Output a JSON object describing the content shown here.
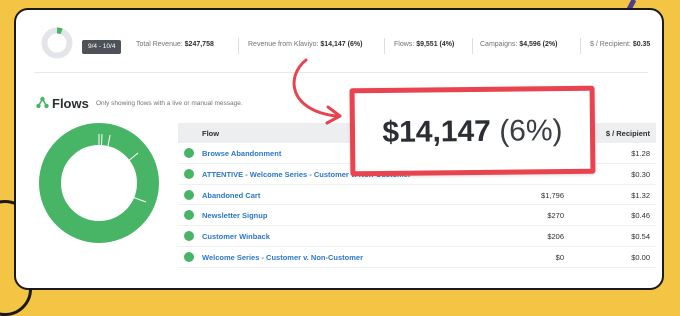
{
  "summary": {
    "date_range": "9/4 - 10/4",
    "stats": [
      {
        "label": "Total Revenue:",
        "value": "$247,758"
      },
      {
        "label": "Revenue from Klaviyo:",
        "value": "$14,147 (6%)"
      },
      {
        "label": "Flows:",
        "value": "$9,551 (4%)"
      },
      {
        "label": "Campaigns:",
        "value": "$4,596 (2%)"
      },
      {
        "label": "$ / Recipient:",
        "value": "$0.35"
      }
    ]
  },
  "flows": {
    "title": "Flows",
    "subtitle": "Only showing flows with a live or manual message.",
    "columns": {
      "flow": "Flow",
      "revenue": "",
      "per_recipient": "$ / Recipient"
    },
    "rows": [
      {
        "name": "Browse Abandonment",
        "revenue": "",
        "per_recipient": "$1.28"
      },
      {
        "name": "ATTENTIVE - Welcome Series - Customer v. Non-Customer",
        "revenue": "",
        "per_recipient": "$0.30"
      },
      {
        "name": "Abandoned Cart",
        "revenue": "$1,796",
        "per_recipient": "$1.32"
      },
      {
        "name": "Newsletter Signup",
        "revenue": "$270",
        "per_recipient": "$0.46"
      },
      {
        "name": "Customer Winback",
        "revenue": "$206",
        "per_recipient": "$0.54"
      },
      {
        "name": "Welcome Series - Customer v. Non-Customer",
        "revenue": "$0",
        "per_recipient": "$0.00"
      }
    ]
  },
  "callout": {
    "amount": "$14,147",
    "percent": "(6%)"
  },
  "colors": {
    "background": "#f4c545",
    "accent_green": "#47b565",
    "link_blue": "#2b77c7",
    "callout_red": "#e8434f",
    "pill_gray": "#4d5258"
  },
  "icons": [
    "flows-icon",
    "arrow-icon"
  ]
}
